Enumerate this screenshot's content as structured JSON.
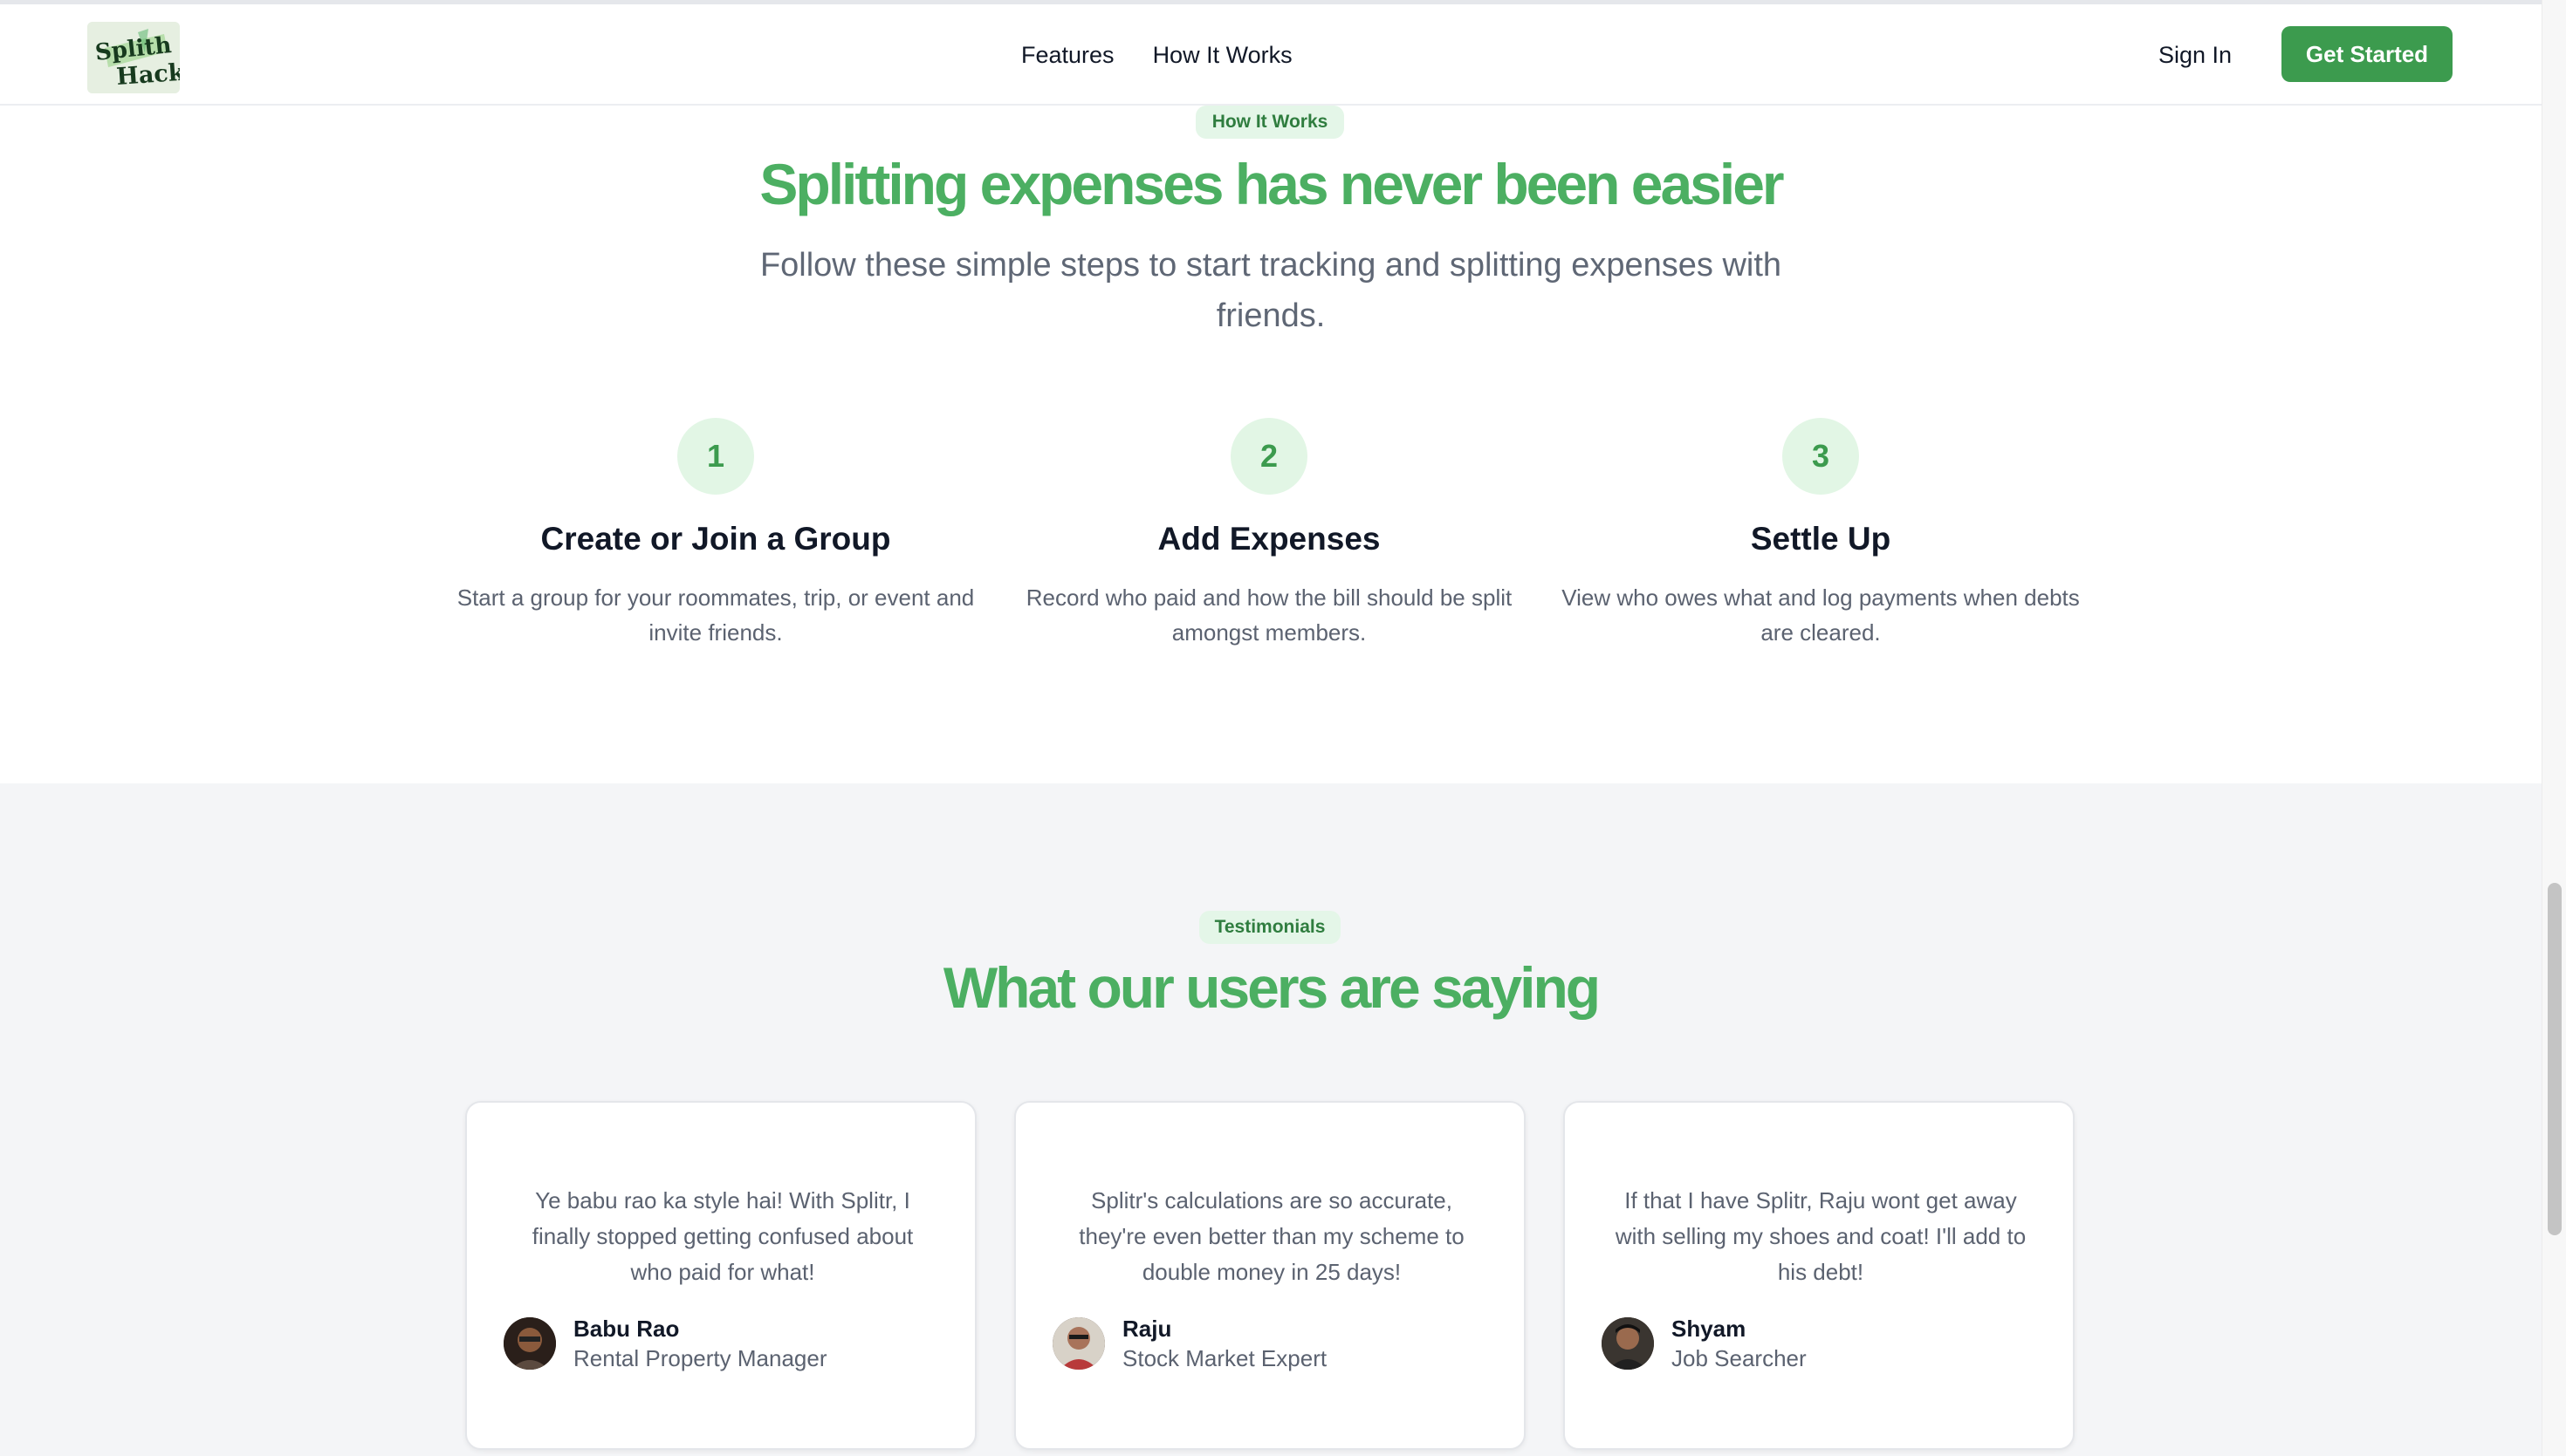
{
  "nav": {
    "logo_text_1": "Splith",
    "logo_text_2": "Hack",
    "links": [
      "Features",
      "How It Works"
    ],
    "signin": "Sign In",
    "cta": "Get Started",
    "brand_color": "#3c9b4e"
  },
  "how": {
    "badge": "How It Works",
    "heading": "Splitting expenses has never been easier",
    "subtitle": "Follow these simple steps to start tracking and splitting expenses with friends.",
    "steps": [
      {
        "num": "1",
        "title": "Create or Join a Group",
        "desc": "Start a group for your roommates, trip, or event and invite friends."
      },
      {
        "num": "2",
        "title": "Add Expenses",
        "desc": "Record who paid and how the bill should be split amongst members."
      },
      {
        "num": "3",
        "title": "Settle Up",
        "desc": "View who owes what and log payments when debts are cleared."
      }
    ]
  },
  "testimonials": {
    "badge": "Testimonials",
    "heading": "What our users are saying",
    "items": [
      {
        "quote": "Ye babu rao ka style hai! With Splitr, I finally stopped getting confused about who paid for what!",
        "name": "Babu Rao",
        "role": "Rental Property Manager"
      },
      {
        "quote": "Splitr's calculations are so accurate, they're even better than my scheme to double money in 25 days!",
        "name": "Raju",
        "role": "Stock Market Expert"
      },
      {
        "quote": "If that I have Splitr, Raju wont get away with selling my shoes and coat! I'll add to his debt!",
        "name": "Shyam",
        "role": "Job Searcher"
      }
    ]
  }
}
